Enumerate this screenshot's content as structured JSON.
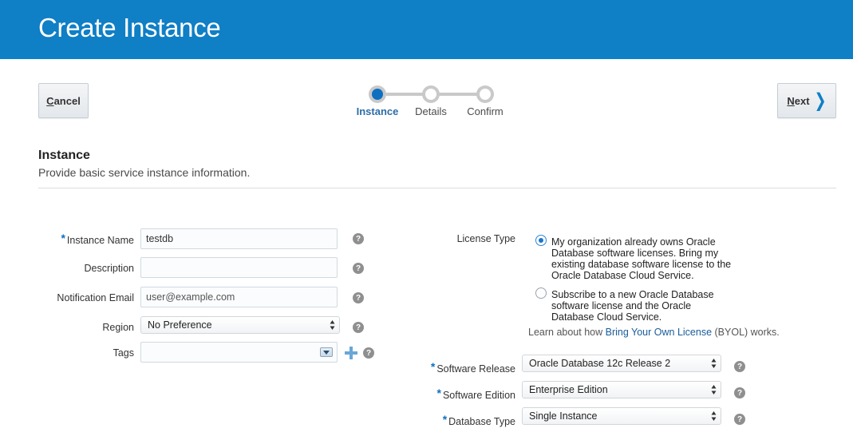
{
  "header": {
    "title": "Create Instance"
  },
  "nav": {
    "cancel_label": "Cancel",
    "next_label": "Next",
    "steps": [
      {
        "label": "Instance",
        "active": true
      },
      {
        "label": "Details",
        "active": false
      },
      {
        "label": "Confirm",
        "active": false
      }
    ]
  },
  "section": {
    "title": "Instance",
    "subtitle": "Provide basic service instance information."
  },
  "form_left": {
    "instance_name": {
      "label": "Instance Name",
      "required": true,
      "value": "testdb"
    },
    "description": {
      "label": "Description",
      "value": ""
    },
    "notification_email": {
      "label": "Notification Email",
      "placeholder": "user@example.com"
    },
    "region": {
      "label": "Region",
      "value": "No Preference"
    },
    "tags": {
      "label": "Tags",
      "value": ""
    }
  },
  "license": {
    "label": "License Type",
    "options": [
      {
        "text": "My organization already owns Oracle Database software licenses. Bring my existing database software license to the Oracle Database Cloud Service.",
        "selected": true
      },
      {
        "text": "Subscribe to a new Oracle Database software license and the Oracle Database Cloud Service.",
        "selected": false
      }
    ],
    "note_prefix": "Learn about how ",
    "note_link": "Bring Your Own License",
    "note_suffix": " (BYOL) works."
  },
  "form_right": {
    "software_release": {
      "label": "Software Release",
      "required": true,
      "value": "Oracle Database 12c Release 2"
    },
    "software_edition": {
      "label": "Software Edition",
      "required": true,
      "value": "Enterprise Edition"
    },
    "database_type": {
      "label": "Database Type",
      "required": true,
      "value": "Single Instance"
    }
  },
  "icons": {
    "help": "help-icon",
    "add": "plus-icon",
    "next": "chevron-right-icon",
    "dropdown": "combo-dropdown-icon"
  },
  "colors": {
    "header_bg": "#0f7fc6",
    "accent": "#0f6fc0",
    "link": "#1a5c99"
  }
}
